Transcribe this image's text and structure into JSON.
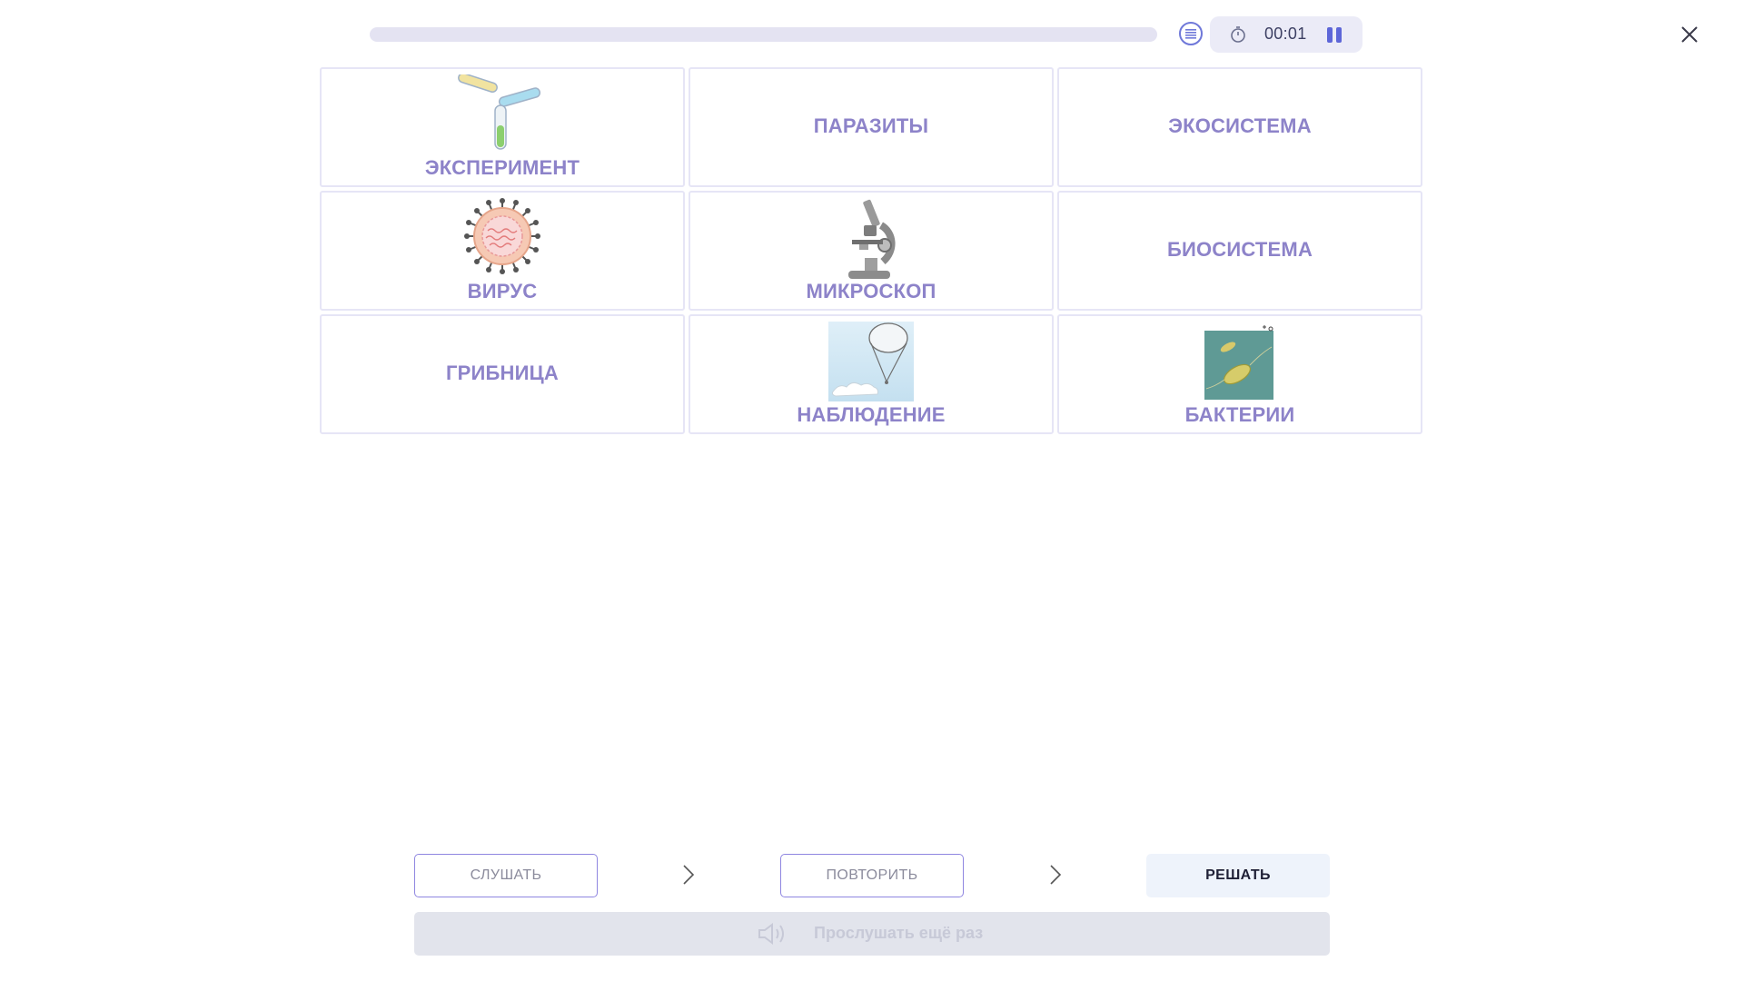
{
  "header": {
    "progress": 0,
    "timer": "00:01",
    "icons": {
      "list": "list-icon",
      "timer": "stopwatch-icon",
      "pause": "pause-icon",
      "close": "close-icon"
    }
  },
  "cards": [
    {
      "label": "ЭКСПЕРИМЕНТ",
      "image": "test-tubes-image"
    },
    {
      "label": "ПАРАЗИТЫ",
      "image": null
    },
    {
      "label": "ЭКОСИСТЕМА",
      "image": null
    },
    {
      "label": "ВИРУС",
      "image": "virus-image"
    },
    {
      "label": "МИКРОСКОП",
      "image": "microscope-image"
    },
    {
      "label": "БИОСИСТЕМА",
      "image": null
    },
    {
      "label": "ГРИБНИЦА",
      "image": null
    },
    {
      "label": "НАБЛЮДЕНИЕ",
      "image": "observation-balloon-image"
    },
    {
      "label": "БАКТЕРИИ",
      "image": "bacteria-micrograph-image"
    }
  ],
  "footer": {
    "listen_label": "СЛУШАТЬ",
    "repeat_label": "ПОВТОРИТЬ",
    "solve_label": "РЕШАТЬ",
    "replay_label": "Прослушать ещё раз",
    "replay_icon": "speaker-icon",
    "arrow_icon": "chevron-right-icon"
  },
  "colors": {
    "accent": "#5d66d8",
    "card_text": "#8d83c9",
    "card_border": "#e6e5f6",
    "progress_track": "#e4e3f2"
  }
}
